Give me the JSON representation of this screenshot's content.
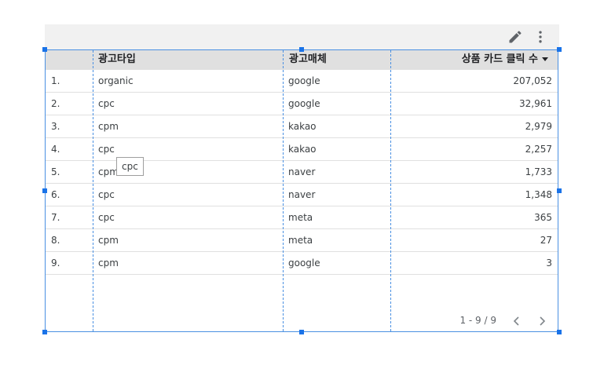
{
  "toolbar": {
    "edit_icon": "pencil-icon",
    "more_icon": "more-vert-icon"
  },
  "table": {
    "headers": {
      "index": "",
      "ad_type": "광고타입",
      "ad_media": "광고매체",
      "product_card_clicks": "상품 카드 클릭 수"
    },
    "sort": "descending",
    "rows": [
      {
        "index": "1.",
        "ad_type": "organic",
        "ad_media": "google",
        "clicks": "207,052"
      },
      {
        "index": "2.",
        "ad_type": "cpc",
        "ad_media": "google",
        "clicks": "32,961"
      },
      {
        "index": "3.",
        "ad_type": "cpm",
        "ad_media": "kakao",
        "clicks": "2,979"
      },
      {
        "index": "4.",
        "ad_type": "cpc",
        "ad_media": "kakao",
        "clicks": "2,257"
      },
      {
        "index": "5.",
        "ad_type": "cpm",
        "ad_media": "naver",
        "clicks": "1,733"
      },
      {
        "index": "6.",
        "ad_type": "cpc",
        "ad_media": "naver",
        "clicks": "1,348"
      },
      {
        "index": "7.",
        "ad_type": "cpc",
        "ad_media": "meta",
        "clicks": "365"
      },
      {
        "index": "8.",
        "ad_type": "cpm",
        "ad_media": "meta",
        "clicks": "27"
      },
      {
        "index": "9.",
        "ad_type": "cpm",
        "ad_media": "google",
        "clicks": "3"
      }
    ],
    "tooltip": "cpc",
    "pagination": {
      "range": "1 - 9 / 9",
      "prev_icon": "chevron-left-icon",
      "next_icon": "chevron-right-icon"
    }
  },
  "colors": {
    "selection": "#4a90e2",
    "handle": "#1a73e8",
    "header_bg": "#e0e0e0",
    "toolbar_bg": "#f1f1f1"
  }
}
